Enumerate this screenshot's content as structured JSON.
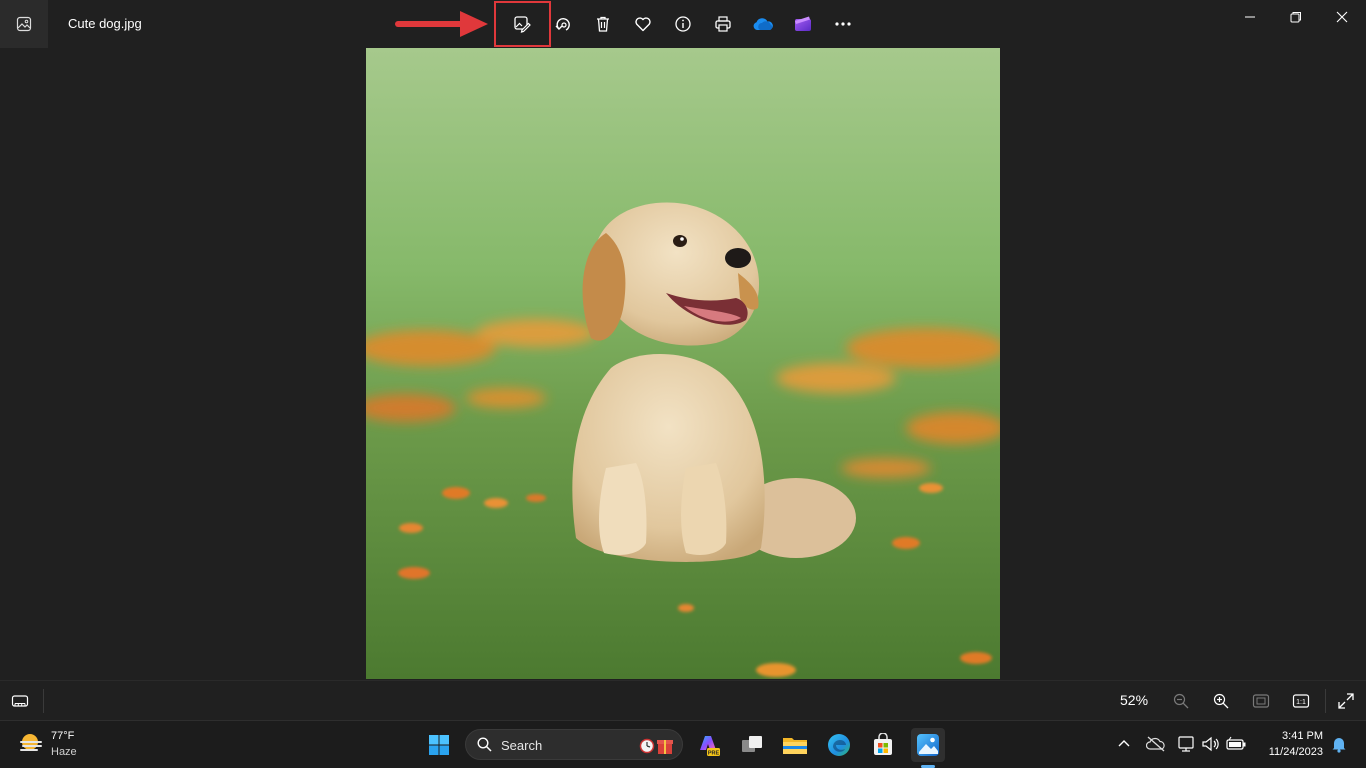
{
  "window": {
    "title": "Cute dog.jpg"
  },
  "toolbar": {
    "items": [
      {
        "name": "edit-image-icon"
      },
      {
        "name": "rotate-icon"
      },
      {
        "name": "delete-icon"
      },
      {
        "name": "favorite-heart-icon"
      },
      {
        "name": "info-icon"
      },
      {
        "name": "print-icon"
      },
      {
        "name": "onedrive-icon"
      },
      {
        "name": "clipchamp-icon"
      },
      {
        "name": "more-icon"
      }
    ],
    "highlight_color": "#e0383b"
  },
  "window_controls": [
    "minimize-icon",
    "restore-icon",
    "close-icon"
  ],
  "viewer": {
    "zoom_label": "52%"
  },
  "taskbar": {
    "weather": {
      "temp": "77°F",
      "condition": "Haze"
    },
    "search": {
      "placeholder": "Search"
    },
    "clock": {
      "time": "3:41 PM",
      "date": "11/24/2023"
    }
  }
}
